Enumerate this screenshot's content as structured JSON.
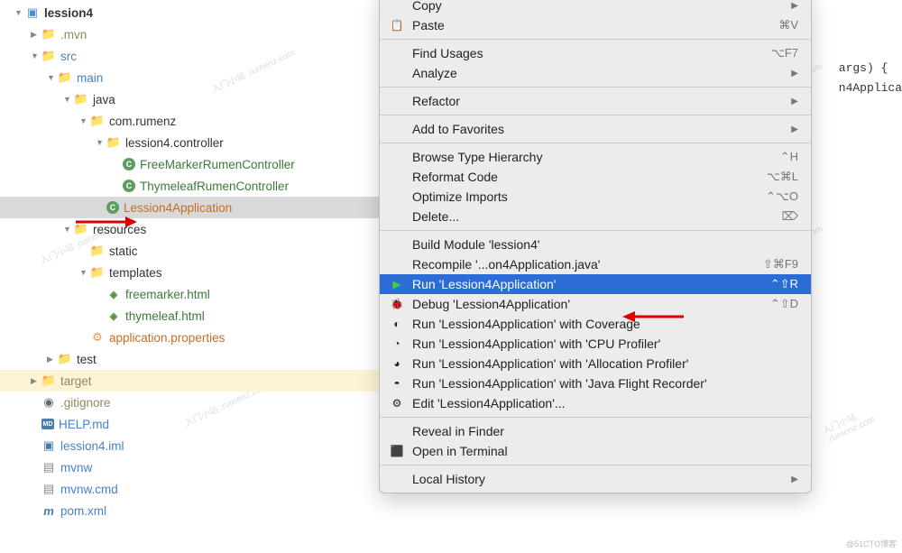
{
  "tree": {
    "root": "lession4",
    "mvn": ".mvn",
    "src": "src",
    "main": "main",
    "java": "java",
    "pkg": "com.rumenz",
    "ctrl_pkg": "lession4.controller",
    "ctrl1": "FreeMarkerRumenController",
    "ctrl2": "ThymeleafRumenController",
    "app": "Lession4Application",
    "resources": "resources",
    "static": "static",
    "templates": "templates",
    "fm_html": "freemarker.html",
    "ty_html": "thymeleaf.html",
    "props": "application.properties",
    "test": "test",
    "target": "target",
    "gitignore": ".gitignore",
    "help": "HELP.md",
    "iml": "lession4.iml",
    "mvnw": "mvnw",
    "mvnwcmd": "mvnw.cmd",
    "pom": "pom.xml"
  },
  "menu": {
    "copy": "Copy",
    "paste": "Paste",
    "paste_sc": "⌘V",
    "find": "Find Usages",
    "find_sc": "⌥F7",
    "analyze": "Analyze",
    "refactor": "Refactor",
    "fav": "Add to Favorites",
    "browse": "Browse Type Hierarchy",
    "browse_sc": "⌃H",
    "reformat": "Reformat Code",
    "reformat_sc": "⌥⌘L",
    "optimize": "Optimize Imports",
    "optimize_sc": "⌃⌥O",
    "delete": "Delete...",
    "delete_sc": "⌦",
    "build": "Build Module 'lession4'",
    "recompile": "Recompile '...on4Application.java'",
    "recompile_sc": "⇧⌘F9",
    "run": "Run 'Lession4Application'",
    "run_sc": "⌃⇧R",
    "debug": "Debug 'Lession4Application'",
    "debug_sc": "⌃⇧D",
    "coverage": "Run 'Lession4Application' with Coverage",
    "cpu": "Run 'Lession4Application' with 'CPU Profiler'",
    "alloc": "Run 'Lession4Application' with 'Allocation Profiler'",
    "flight": "Run 'Lession4Application' with 'Java Flight Recorder'",
    "edit": "Edit 'Lession4Application'...",
    "reveal": "Reveal in Finder",
    "terminal": "Open in Terminal",
    "history": "Local History"
  },
  "editor": {
    "line1": " args) {",
    "line2": "n4Applica"
  },
  "watermark": "入门小站 .rumenz.com",
  "footer": "@51CTO博客"
}
